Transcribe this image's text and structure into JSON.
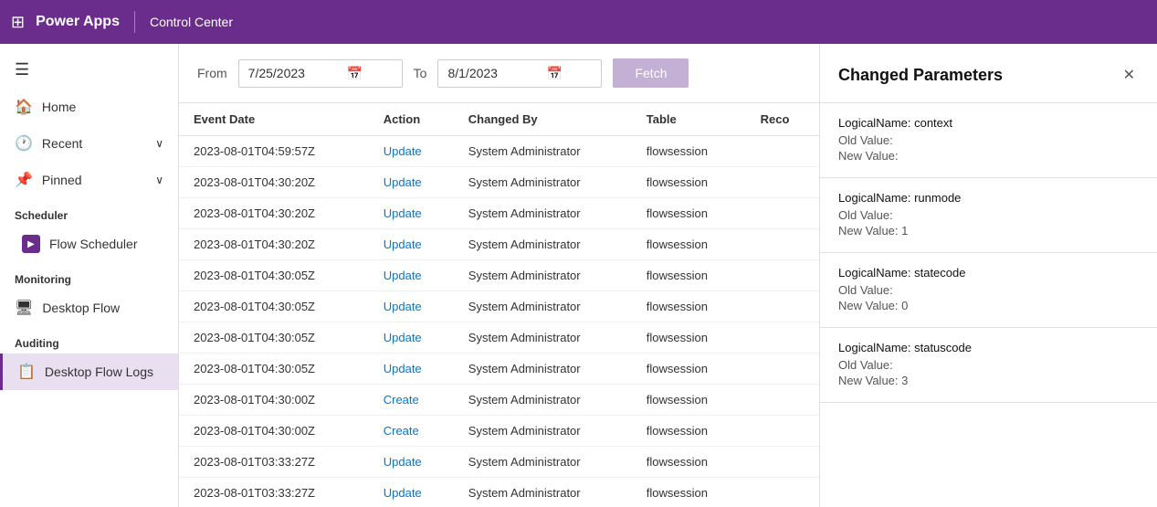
{
  "topbar": {
    "grid_icon": "⊞",
    "title": "Power Apps",
    "divider": true,
    "subtitle": "Control Center"
  },
  "sidebar": {
    "hamburger_icon": "☰",
    "items": [
      {
        "id": "home",
        "icon": "🏠",
        "label": "Home",
        "has_chevron": false
      },
      {
        "id": "recent",
        "icon": "🕐",
        "label": "Recent",
        "has_chevron": true
      },
      {
        "id": "pinned",
        "icon": "📌",
        "label": "Pinned",
        "has_chevron": true
      }
    ],
    "scheduler_label": "Scheduler",
    "flow_scheduler_label": "Flow Scheduler",
    "monitoring_label": "Monitoring",
    "desktop_flow_label": "Desktop Flow",
    "auditing_label": "Auditing",
    "desktop_flow_logs_label": "Desktop Flow Logs"
  },
  "toolbar": {
    "from_label": "From",
    "from_date": "7/25/2023",
    "to_label": "To",
    "to_date": "8/1/2023",
    "fetch_label": "Fetch"
  },
  "table": {
    "columns": [
      "Event Date",
      "Action",
      "Changed By",
      "Table",
      "Reco"
    ],
    "rows": [
      {
        "date": "2023-08-01T04:59:57Z",
        "action": "Update",
        "changed_by": "System Administrator",
        "table": "flowsession",
        "record": ""
      },
      {
        "date": "2023-08-01T04:30:20Z",
        "action": "Update",
        "changed_by": "System Administrator",
        "table": "flowsession",
        "record": ""
      },
      {
        "date": "2023-08-01T04:30:20Z",
        "action": "Update",
        "changed_by": "System Administrator",
        "table": "flowsession",
        "record": ""
      },
      {
        "date": "2023-08-01T04:30:20Z",
        "action": "Update",
        "changed_by": "System Administrator",
        "table": "flowsession",
        "record": ""
      },
      {
        "date": "2023-08-01T04:30:05Z",
        "action": "Update",
        "changed_by": "System Administrator",
        "table": "flowsession",
        "record": ""
      },
      {
        "date": "2023-08-01T04:30:05Z",
        "action": "Update",
        "changed_by": "System Administrator",
        "table": "flowsession",
        "record": ""
      },
      {
        "date": "2023-08-01T04:30:05Z",
        "action": "Update",
        "changed_by": "System Administrator",
        "table": "flowsession",
        "record": ""
      },
      {
        "date": "2023-08-01T04:30:05Z",
        "action": "Update",
        "changed_by": "System Administrator",
        "table": "flowsession",
        "record": ""
      },
      {
        "date": "2023-08-01T04:30:00Z",
        "action": "Create",
        "changed_by": "System Administrator",
        "table": "flowsession",
        "record": ""
      },
      {
        "date": "2023-08-01T04:30:00Z",
        "action": "Create",
        "changed_by": "System Administrator",
        "table": "flowsession",
        "record": ""
      },
      {
        "date": "2023-08-01T03:33:27Z",
        "action": "Update",
        "changed_by": "System Administrator",
        "table": "flowsession",
        "record": ""
      },
      {
        "date": "2023-08-01T03:33:27Z",
        "action": "Update",
        "changed_by": "System Administrator",
        "table": "flowsession",
        "record": ""
      }
    ]
  },
  "side_panel": {
    "title": "Changed Parameters",
    "close_icon": "✕",
    "params": [
      {
        "logical_name": "LogicalName: context",
        "old_label": "Old Value:",
        "old_value": "",
        "new_label": "New Value:",
        "new_value": ""
      },
      {
        "logical_name": "LogicalName: runmode",
        "old_label": "Old Value:",
        "old_value": "",
        "new_label": "New Value:",
        "new_value": "1"
      },
      {
        "logical_name": "LogicalName: statecode",
        "old_label": "Old Value:",
        "old_value": "",
        "new_label": "New Value:",
        "new_value": "0"
      },
      {
        "logical_name": "LogicalName: statuscode",
        "old_label": "Old Value:",
        "old_value": "",
        "new_label": "New Value:",
        "new_value": "3"
      }
    ]
  }
}
